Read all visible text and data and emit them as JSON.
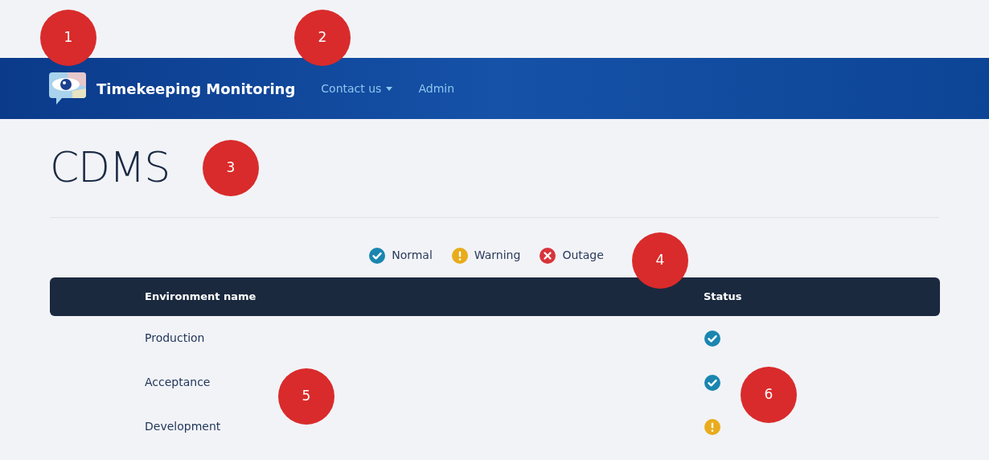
{
  "navbar": {
    "brand": "Timekeeping Monitoring",
    "links": [
      {
        "label": "Contact us",
        "dropdown": true
      },
      {
        "label": "Admin",
        "dropdown": false
      }
    ]
  },
  "title": "CDMS",
  "legend": [
    {
      "kind": "normal",
      "label": "Normal"
    },
    {
      "kind": "warning",
      "label": "Warning"
    },
    {
      "kind": "outage",
      "label": "Outage"
    }
  ],
  "table": {
    "columns": [
      "Environment name",
      "Status"
    ],
    "rows": [
      {
        "name": "Production",
        "kind": "normal"
      },
      {
        "name": "Acceptance",
        "kind": "normal"
      },
      {
        "name": "Development",
        "kind": "warning"
      }
    ]
  },
  "callouts": [
    "1",
    "2",
    "3",
    "4",
    "5",
    "6"
  ]
}
